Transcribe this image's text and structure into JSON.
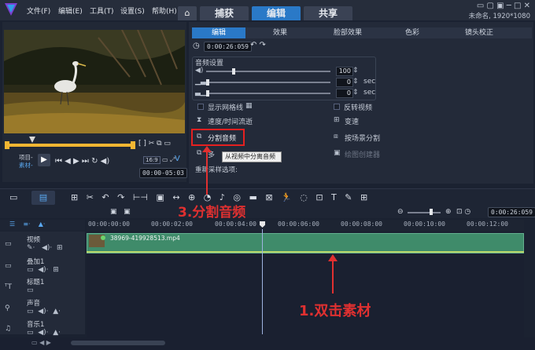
{
  "titlebar": {
    "menus": [
      "文件(F)",
      "编辑(E)",
      "工具(T)",
      "设置(S)",
      "帮助(H)"
    ],
    "tabs": [
      "捕获",
      "编辑",
      "共享"
    ],
    "project_info": "未命名, 1920*1080",
    "window_controls": "▭ ▢ ▣  ─  □  ✕"
  },
  "player": {
    "labels": [
      "项目-",
      "素材-"
    ],
    "timecode": "00:00-05:03",
    "speed": "16:9"
  },
  "options": {
    "tabs": [
      "编辑",
      "效果",
      "脸部效果",
      "色彩",
      "镜头校正"
    ],
    "duration": "0:00:26:059",
    "audio_section": "音频设置",
    "audio_values": [
      "100",
      "0",
      "0"
    ],
    "unit_sec": "sec",
    "show_grid": "显示网格线",
    "reverse": "反转视频",
    "speed_time": "速度/时间流逝",
    "speed": "变速",
    "split_audio": "分割音频",
    "scene_split": "按场景分割",
    "mask": "绘图创建器",
    "resample": "重新采样选项:",
    "tooltip": "从视频中分离音频",
    "partial_label": "多"
  },
  "timeline": {
    "ruler": [
      "00:00:00:00",
      "00:00:02:00",
      "00:00:04:00",
      "00:00:06:00",
      "00:00:08:00",
      "00:00:10:00",
      "00:00:12:00"
    ],
    "zoom_timecode": "0:00:26:059",
    "tracks": [
      "视频",
      "叠加1",
      "标题1",
      "声音",
      "音乐1"
    ],
    "clip_name": "38969-419928513.mp4"
  },
  "annotations": {
    "step3": "3.分割音频",
    "step1": "1.双击素材"
  },
  "colors": {
    "accent": "#2a79c7",
    "annotation": "#e03030",
    "clip": "#3f8b6a"
  }
}
